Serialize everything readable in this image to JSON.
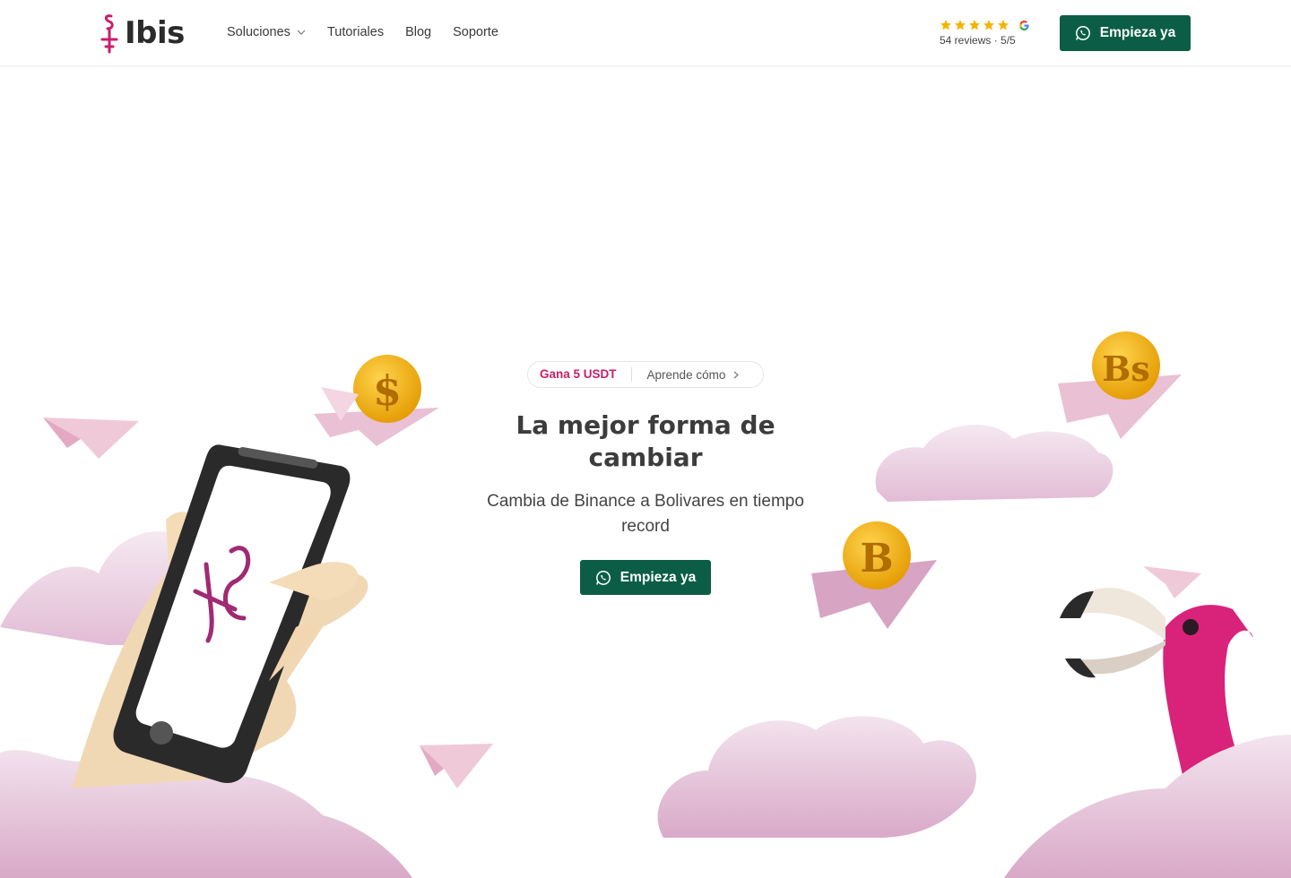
{
  "brand": {
    "name": "Ibis"
  },
  "nav": {
    "items": [
      {
        "label": "Soluciones",
        "has_dropdown": true
      },
      {
        "label": "Tutoriales"
      },
      {
        "label": "Blog"
      },
      {
        "label": "Soporte"
      }
    ]
  },
  "reviews": {
    "stars": 5,
    "text": "54 reviews · 5/5",
    "icon": "google-icon"
  },
  "header_cta": {
    "label": "Empieza ya",
    "icon": "whatsapp-icon"
  },
  "promo": {
    "highlight": "Gana 5 USDT",
    "link": "Aprende cómo"
  },
  "hero": {
    "title": "La mejor forma de cambiar",
    "subtitle": "Cambia de Binance a Bolivares en tiempo record",
    "cta_label": "Empieza ya"
  },
  "illustration": {
    "coins": [
      "$",
      "Bs",
      "B"
    ]
  },
  "colors": {
    "primary_green": "#0b5e45",
    "brand_pink": "#c81e6a",
    "star_gold": "#f5b301",
    "cloud_pink": "#e6c6dc"
  }
}
